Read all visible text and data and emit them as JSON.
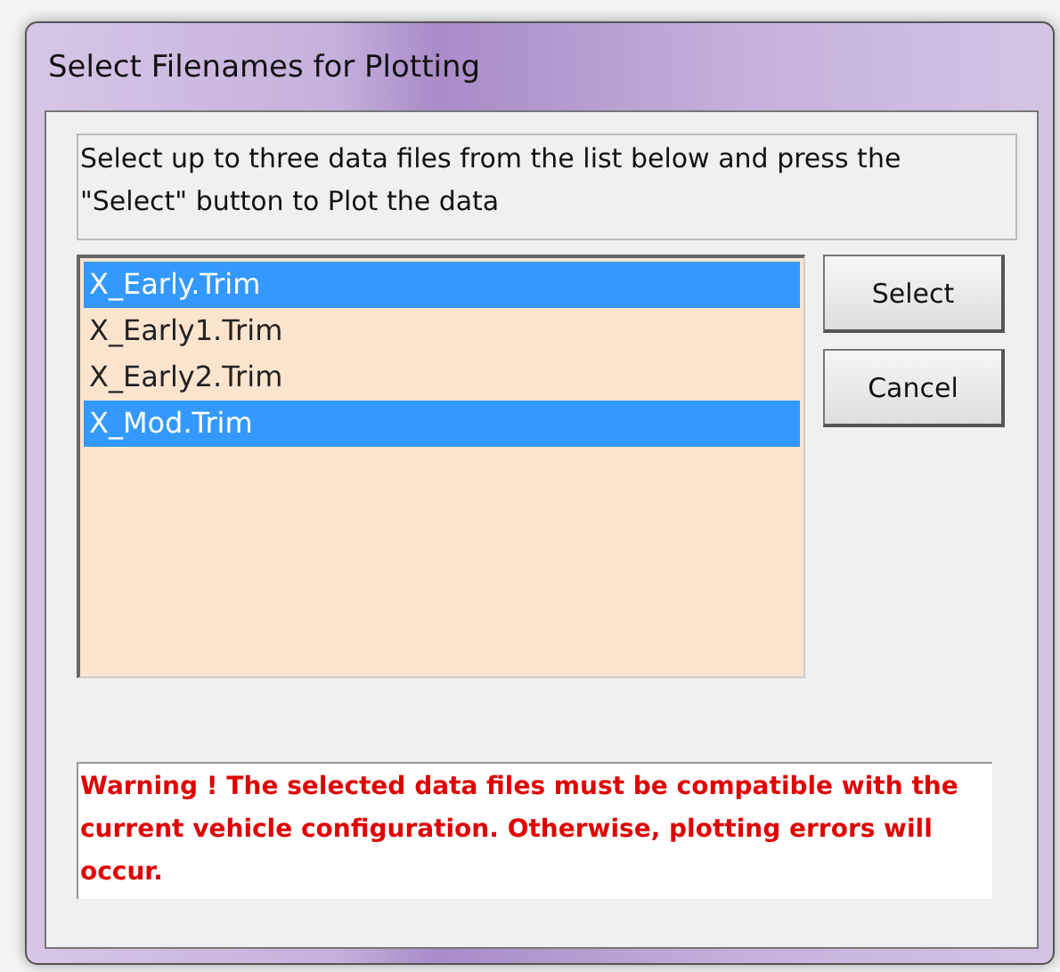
{
  "window": {
    "title": "Select Filenames for Plotting"
  },
  "instructions": "Select up to three data files from the list below and press the \"Select\" button to Plot the data",
  "files": [
    {
      "name": "X_Early.Trim",
      "selected": true
    },
    {
      "name": "X_Early1.Trim",
      "selected": false
    },
    {
      "name": "X_Early2.Trim",
      "selected": false
    },
    {
      "name": "X_Mod.Trim",
      "selected": true
    }
  ],
  "buttons": [
    "Select",
    "Cancel"
  ],
  "warning": "Warning ! The selected data files must be compatible with the current vehicle configuration. Otherwise, plotting errors will occur."
}
